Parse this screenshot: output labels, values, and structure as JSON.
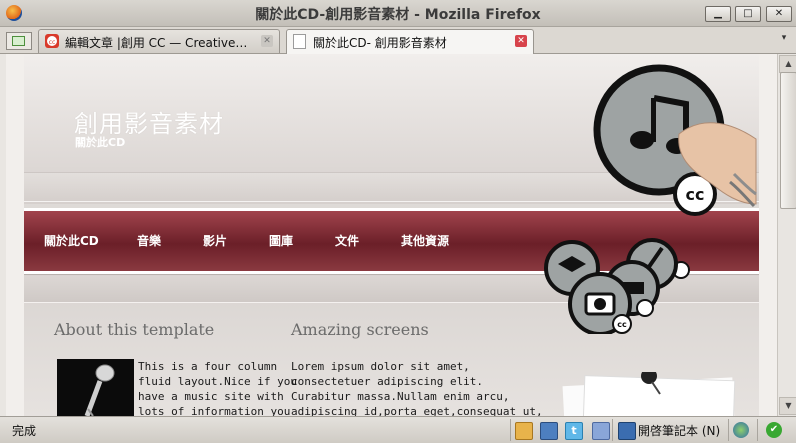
{
  "window": {
    "title": "關於此CD-創用影音素材 - Mozilla Firefox",
    "minimize": "▁",
    "maximize": "□",
    "close": "✕"
  },
  "tabs": [
    {
      "label": "編輯文章 |創用 CC  —  Creative…",
      "active": false
    },
    {
      "label": "關於此CD- 創用影音素材",
      "active": true
    }
  ],
  "tab_list_arrow": "▾",
  "site": {
    "title": "創用影音素材",
    "subtitle": "關於此CD",
    "nav": [
      "關於此CD",
      "音樂",
      "影片",
      "圖庫",
      "文件",
      "其他資源"
    ],
    "columns": [
      {
        "title": "About this template",
        "text": [
          "This is a four column",
          "fluid layout.Nice if you",
          "have a music site with",
          "lots of information you"
        ]
      },
      {
        "title": "Amazing screens",
        "text": [
          "Lorem ipsum dolor sit amet,",
          "consectetuer adipiscing elit.",
          "Curabitur massa.Nullam enim arcu,",
          "adipiscing id,porta eget,consequat ut,"
        ]
      }
    ],
    "cc_badge": "cc"
  },
  "statusbar": {
    "status": "完成",
    "notebook": "開啓筆記本 (N)"
  },
  "colors": {
    "nav_bg": "#7a2a33",
    "page_bg": "#e6e2df",
    "title_text": "#ffffff"
  }
}
